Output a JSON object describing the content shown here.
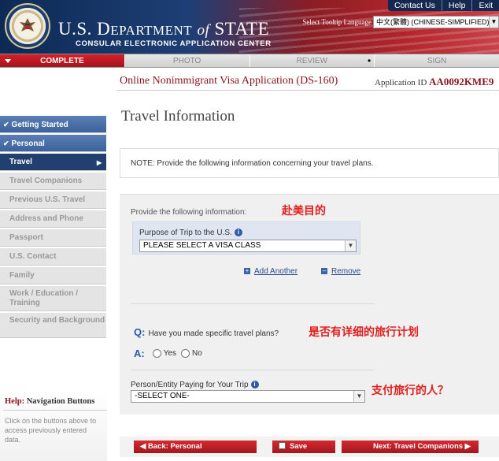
{
  "header": {
    "brand_title_us": "U.S. D",
    "brand_title_ep": "EPARTMENT",
    "brand_title_of": "of",
    "brand_title_st": "STATE",
    "brand_subtitle": "CONSULAR ELECTRONIC APPLICATION CENTER",
    "top_links": [
      "Contact Us",
      "Help",
      "Exit"
    ],
    "language_label": "Select Tooltip Language",
    "language_value": "中文(繁體) (CHINESE-SIMPLIFIED)"
  },
  "progress": {
    "steps": [
      "COMPLETE",
      "PHOTO",
      "REVIEW",
      "",
      "SIGN"
    ]
  },
  "subheader": {
    "app_title": "Online Nonimmigrant Visa Application (DS-160)",
    "app_id_label": "Application ID",
    "app_id_value": "AA0092KME9"
  },
  "sidebar": {
    "items": [
      {
        "label": "Getting Started"
      },
      {
        "label": "Personal"
      },
      {
        "label": "Travel"
      },
      {
        "label": "Travel Companions"
      },
      {
        "label": "Previous U.S. Travel"
      },
      {
        "label": "Address and Phone"
      },
      {
        "label": "Passport"
      },
      {
        "label": "U.S. Contact"
      },
      {
        "label": "Family"
      },
      {
        "label": "Work / Education / Training"
      },
      {
        "label": "Security and Background"
      }
    ]
  },
  "help": {
    "title_prefix": "Help:",
    "title_rest": " Navigation Buttons",
    "text": "Click on the buttons above to access previously entered data."
  },
  "main": {
    "page_title": "Travel Information",
    "note": "NOTE: Provide the following information concerning your travel plans.",
    "provide_label": "Provide the following information:",
    "purpose_label": "Purpose of Trip to the U.S.",
    "purpose_value": "PLEASE SELECT A VISA CLASS",
    "add_link": "Add Another",
    "remove_link": "Remove",
    "question_prefix": "Q:",
    "question": "Have you made specific travel plans?",
    "answer_prefix": "A:",
    "answer_yes": "Yes",
    "answer_no": "No",
    "payer_label": "Person/Entity Paying for Your Trip",
    "payer_value": "-SELECT ONE-",
    "annotations": [
      "赴美目的",
      "是否有详细的旅行计划",
      "支付旅行的人？"
    ]
  },
  "footer": {
    "back_label": "Back: Personal",
    "save_label": "Save",
    "next_label": "Next: Travel Companions"
  }
}
